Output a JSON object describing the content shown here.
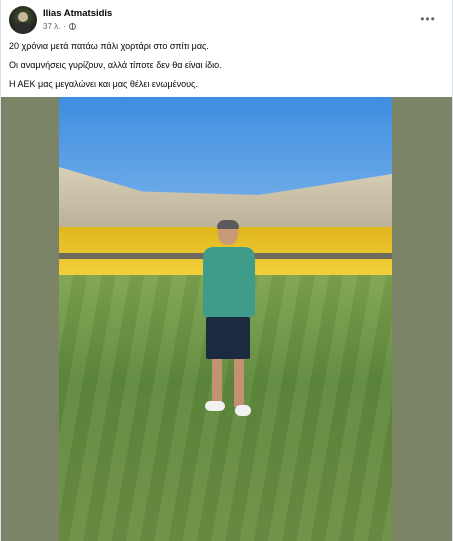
{
  "post": {
    "author": "Ilias Atmatsidis",
    "time": "37 λ.",
    "more_label": "•••",
    "text_lines": [
      "20 χρόνια μετά πατάω πάλι χορτάρι στο σπίτι μας.",
      "Οι αναμνήσεις γυρίζουν, αλλά τίποτε δεν θα είναι ίδιο.",
      "Η ΑΕΚ μας μεγαλώνει και μας θέλει ενωμένους."
    ]
  },
  "colors": {
    "side_panels": "#7b8466",
    "sky": "#3e8de0",
    "seats": "#f2cf3b",
    "grass": "#6c8f43"
  },
  "icons": [
    "avatar",
    "globe-icon",
    "more-icon"
  ]
}
